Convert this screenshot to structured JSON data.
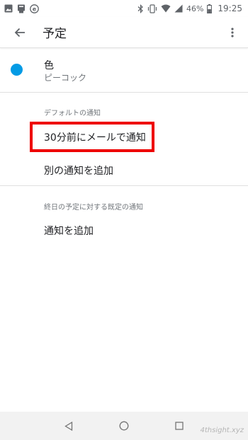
{
  "status_bar": {
    "battery_percent": "46%",
    "time": "19:25",
    "icons": [
      "image-icon",
      "card-icon",
      "e-icon",
      "bluetooth-icon",
      "vibrate-icon",
      "wifi-icon",
      "signal-icon",
      "battery-icon"
    ]
  },
  "app_bar": {
    "title": "予定"
  },
  "color_setting": {
    "label": "色",
    "value": "ピーコック",
    "dot_color": "#039be5"
  },
  "default_notifications": {
    "section_label": "デフォルトの通知",
    "items": [
      {
        "label": "30分前にメールで通知",
        "highlighted": true
      },
      {
        "label": "別の通知を追加"
      }
    ]
  },
  "all_day_notifications": {
    "section_label": "終日の予定に対する既定の通知",
    "items": [
      {
        "label": "通知を追加"
      }
    ]
  },
  "highlight_color": "#ee0000",
  "watermark": "4thsight.xyz"
}
